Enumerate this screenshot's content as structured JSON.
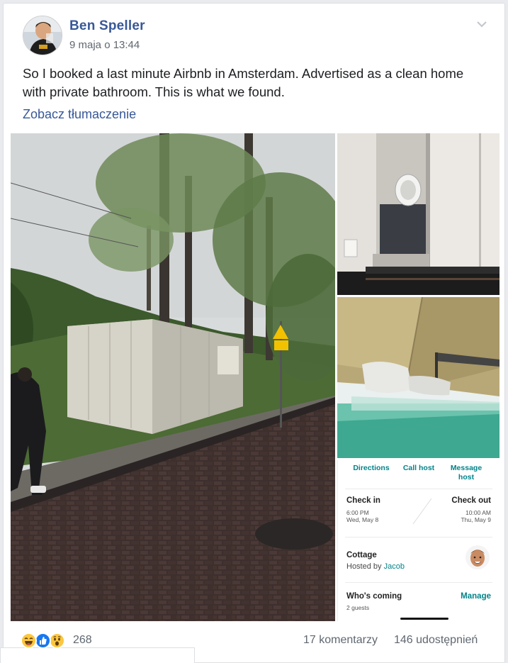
{
  "post": {
    "author": "Ben Speller",
    "timestamp": "9 maja o 13:44",
    "text": "So I booked a last minute Airbnb in Amsterdam. Advertised as a clean home with private bathroom. This is what we found.",
    "translate_link": "Zobacz tłumaczenie"
  },
  "app_screenshot": {
    "actions": [
      "Directions",
      "Call host",
      "Message host"
    ],
    "check_in": {
      "label": "Check in",
      "time": "6:00 PM",
      "date": "Wed, May 8"
    },
    "check_out": {
      "label": "Check out",
      "time": "10:00 AM",
      "date": "Thu, May 9"
    },
    "listing_type": "Cottage",
    "hosted_by_prefix": "Hosted by",
    "host_name": "Jacob",
    "whos_coming": "Who's coming",
    "guests": "2 guests",
    "manage": "Manage"
  },
  "footer": {
    "reaction_icons": [
      "haha-icon",
      "like-icon",
      "wow-icon"
    ],
    "reaction_count": "268",
    "comments": "17 komentarzy",
    "shares": "146 udostępnień"
  },
  "colors": {
    "link": "#385898",
    "airbnb_teal": "#008489",
    "like_blue": "#1877f2",
    "reaction_yellow": "#fcc73f"
  }
}
